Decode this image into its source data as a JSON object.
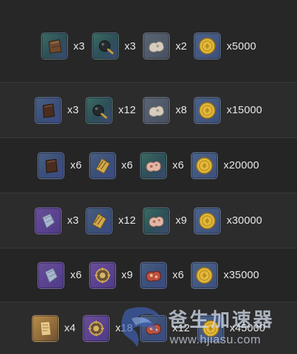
{
  "rows": [
    {
      "rewards": [
        {
          "icon": "leather-pouch-icon",
          "qty": "x3"
        },
        {
          "icon": "bomb-icon",
          "qty": "x3"
        },
        {
          "icon": "ore-chunk-icon",
          "qty": "x2"
        },
        {
          "icon": "gold-coin-icon",
          "qty": "x5000"
        }
      ]
    },
    {
      "rewards": [
        {
          "icon": "dark-pouch-icon",
          "qty": "x3"
        },
        {
          "icon": "bomb-icon",
          "qty": "x12"
        },
        {
          "icon": "ore-chunk-icon",
          "qty": "x8"
        },
        {
          "icon": "gold-coin-icon",
          "qty": "x15000"
        }
      ]
    },
    {
      "rewards": [
        {
          "icon": "dark-pouch-icon",
          "qty": "x6"
        },
        {
          "icon": "gold-scroll-icon",
          "qty": "x6"
        },
        {
          "icon": "pink-ore-icon",
          "qty": "x6"
        },
        {
          "icon": "gold-coin-icon",
          "qty": "x20000"
        }
      ]
    },
    {
      "rewards": [
        {
          "icon": "purple-crystal-icon",
          "qty": "x3"
        },
        {
          "icon": "gold-scroll-icon",
          "qty": "x12"
        },
        {
          "icon": "pink-ore-icon",
          "qty": "x9"
        },
        {
          "icon": "gold-coin-icon",
          "qty": "x30000"
        }
      ]
    },
    {
      "rewards": [
        {
          "icon": "purple-crystal-icon",
          "qty": "x6"
        },
        {
          "icon": "emblem-icon",
          "qty": "x9"
        },
        {
          "icon": "red-ore-icon",
          "qty": "x6"
        },
        {
          "icon": "gold-coin-icon",
          "qty": "x35000"
        }
      ]
    },
    {
      "rewards": [
        {
          "icon": "golden-parchment-icon",
          "qty": "x4"
        },
        {
          "icon": "emblem-icon",
          "qty": "x18"
        },
        {
          "icon": "red-ore-icon",
          "qty": "x12"
        },
        {
          "icon": "gold-coin-icon",
          "qty": "x45000"
        }
      ]
    }
  ],
  "watermark": {
    "title": "爸生加速器",
    "url": "www.hjiasu.com"
  },
  "colors": {
    "background": "#1c1c1c",
    "row_border": "#3a3a3a",
    "text": "#e9e9e9",
    "coin": "#e3b93a"
  }
}
